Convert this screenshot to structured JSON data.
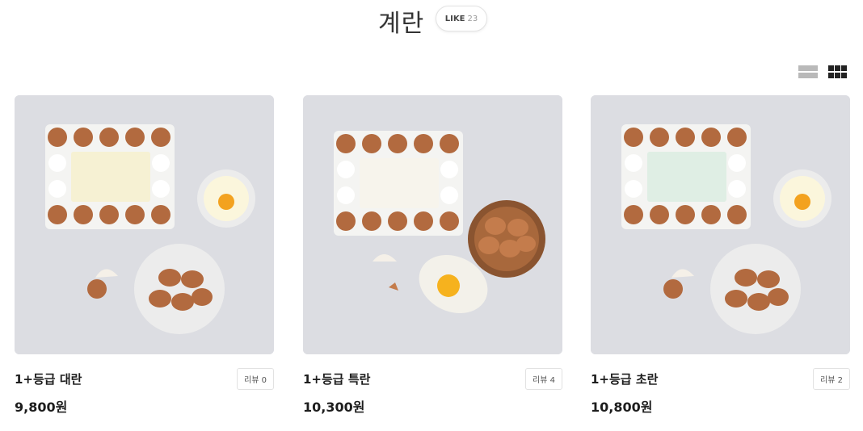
{
  "header": {
    "title": "계란",
    "like_label": "LIKE",
    "like_count": "23"
  },
  "view_toggle": {
    "list_icon": "list-view-icon",
    "grid_icon": "grid-view-icon",
    "active": "grid"
  },
  "colors": {
    "tray": "#f4f4f2",
    "egg": "#b26a3f",
    "background": "#dcdde2",
    "label_green": "#dfeee4",
    "label_yellow": "#f6f1d3"
  },
  "products": [
    {
      "name": "1+등급 대란",
      "price": "9,800원",
      "review": "리뷰 0"
    },
    {
      "name": "1+등급 특란",
      "price": "10,300원",
      "review": "리뷰 4"
    },
    {
      "name": "1+등급 초란",
      "price": "10,800원",
      "review": "리뷰 2"
    }
  ]
}
